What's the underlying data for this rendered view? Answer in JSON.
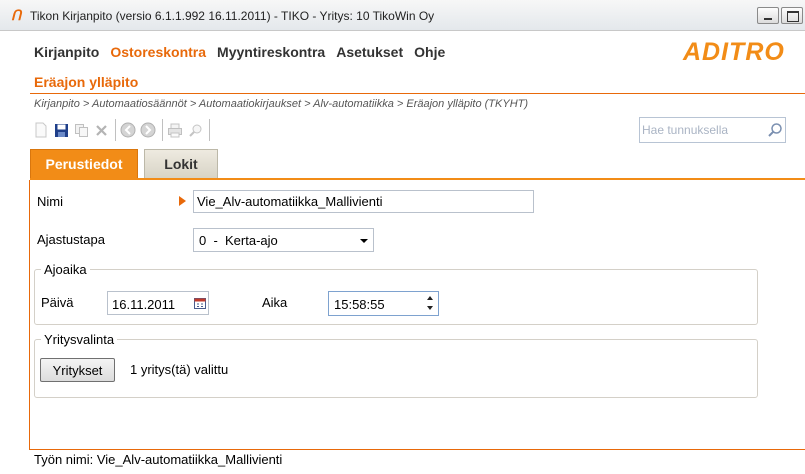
{
  "window": {
    "title": "Tikon Kirjanpito (versio 6.1.1.992 16.11.2011) - TIKO - Yritys: 10 TikoWin Oy",
    "app_icon_glyph": "Ո"
  },
  "menu": {
    "items": [
      "Kirjanpito",
      "Ostoreskontra",
      "Myyntireskontra",
      "Asetukset",
      "Ohje"
    ],
    "active_index": 1
  },
  "logo": {
    "text": "ADITRO",
    "color": "#f28c17"
  },
  "page": {
    "title": "Eräajon ylläpito",
    "breadcrumb": "Kirjanpito > Automaatiosäännöt > Automaatiokirjaukset > Alv-automatiikka > Eräajon ylläpito  (TKYHT)"
  },
  "toolbar": {
    "icons": [
      "new-icon",
      "save-icon",
      "copy-icon",
      "delete-icon",
      "back-icon",
      "forward-icon",
      "print-icon",
      "print-preview-icon"
    ]
  },
  "search": {
    "placeholder": "Hae tunnuksella"
  },
  "tabs": [
    {
      "label": "Perustiedot",
      "active": true
    },
    {
      "label": "Lokit",
      "active": false
    }
  ],
  "form": {
    "name_label": "Nimi",
    "name_value": "Vie_Alv-automatiikka_Mallivienti",
    "schedule_label": "Ajastustapa",
    "schedule_value": "0  -  Kerta-ajo",
    "runtime_group": "Ajoaika",
    "day_label": "Päivä",
    "day_value": "16.11.2011",
    "time_label": "Aika",
    "time_value": "15:58:55",
    "company_group": "Yritysvalinta",
    "companies_button": "Yritykset",
    "companies_selected": "1 yritys(tä) valittu"
  },
  "status": {
    "text": "Työn nimi: Vie_Alv-automatiikka_Mallivienti"
  },
  "colors": {
    "accent": "#e8690a",
    "tab_active": "#f28c17"
  }
}
